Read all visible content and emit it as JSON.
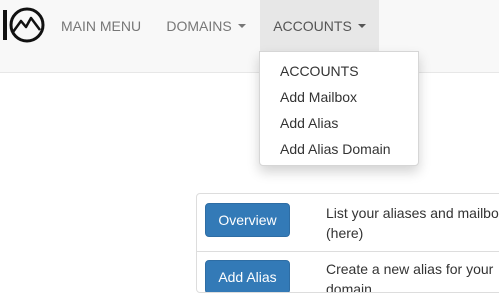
{
  "logo": {
    "text": "10"
  },
  "navbar": {
    "items": [
      {
        "label": "MAIN MENU"
      },
      {
        "label": "DOMAINS"
      },
      {
        "label": "ACCOUNTS"
      }
    ]
  },
  "accounts_menu": {
    "items": [
      {
        "label": "ACCOUNTS"
      },
      {
        "label": "Add Mailbox"
      },
      {
        "label": "Add Alias"
      },
      {
        "label": "Add Alias Domain"
      }
    ]
  },
  "actions": {
    "rows": [
      {
        "button": "Overview",
        "description": "List your aliases and mailboxes (here)"
      },
      {
        "button": "Add Alias",
        "description": "Create a new alias for your domain"
      }
    ]
  },
  "colors": {
    "navbar_bg": "#f8f8f8",
    "active_nav_bg": "#e7e7e7",
    "primary_button": "#337ab7"
  }
}
